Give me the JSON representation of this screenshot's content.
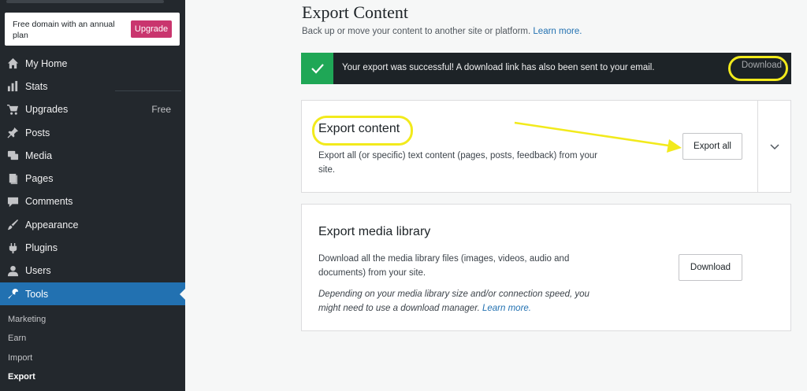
{
  "sidebar": {
    "promo": {
      "text": "Free domain with an annual plan",
      "button": "Upgrade"
    },
    "items": [
      {
        "label": "My Home",
        "icon": "home-icon"
      },
      {
        "label": "Stats",
        "icon": "stats-icon"
      },
      {
        "label": "Upgrades",
        "icon": "cart-icon",
        "badge": "Free"
      },
      {
        "label": "Posts",
        "icon": "pin-icon"
      },
      {
        "label": "Media",
        "icon": "media-icon"
      },
      {
        "label": "Pages",
        "icon": "pages-icon"
      },
      {
        "label": "Comments",
        "icon": "comment-icon"
      },
      {
        "label": "Appearance",
        "icon": "brush-icon"
      },
      {
        "label": "Plugins",
        "icon": "plugin-icon"
      },
      {
        "label": "Users",
        "icon": "user-icon"
      },
      {
        "label": "Tools",
        "icon": "wrench-icon"
      }
    ],
    "submenu": [
      "Marketing",
      "Earn",
      "Import",
      "Export"
    ]
  },
  "main": {
    "title": "Export Content",
    "subtitle": "Back up or move your content to another site or platform.",
    "subtitle_link": "Learn more.",
    "notice": {
      "text": "Your export was successful! A download link has also been sent to your email.",
      "action": "Download"
    },
    "export_card": {
      "title": "Export content",
      "desc": "Export all (or specific) text content (pages, posts, feedback) from your site.",
      "button": "Export all"
    },
    "media_card": {
      "title": "Export media library",
      "desc": "Download all the media library files (images, videos, audio and documents) from your site.",
      "note": "Depending on your media library size and/or connection speed, you might need to use a download manager.",
      "note_link": "Learn more.",
      "button": "Download"
    }
  },
  "colors": {
    "sidebar_bg": "#23282d",
    "active_bg": "#2271b1",
    "upgrade_btn": "#c9356e",
    "success_green": "#1fa756",
    "highlight": "#f2ea1c"
  }
}
